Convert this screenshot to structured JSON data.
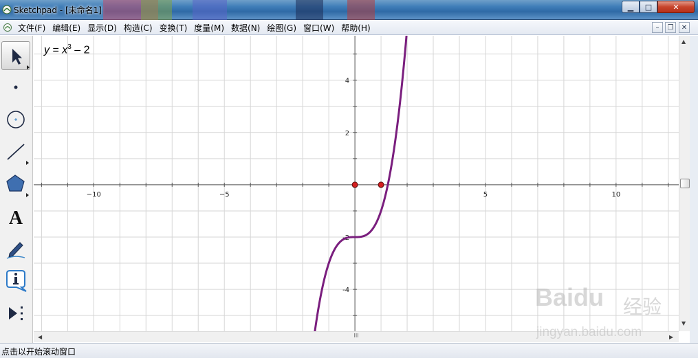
{
  "window": {
    "title": "Sketchpad  - [未命名1]",
    "min_glyph": "▁",
    "max_glyph": "□",
    "close_glyph": "✕"
  },
  "menu": {
    "items": [
      "文件(F)",
      "编辑(E)",
      "显示(D)",
      "构造(C)",
      "变换(T)",
      "度量(M)",
      "数据(N)",
      "绘图(G)",
      "窗口(W)",
      "帮助(H)"
    ],
    "mdi_min": "–",
    "mdi_restore": "❐",
    "mdi_close": "✕"
  },
  "toolbox": {
    "tools": [
      {
        "name": "arrow-tool",
        "icon": "arrow-pointer-icon",
        "selected": true
      },
      {
        "name": "point-tool",
        "icon": "point-icon"
      },
      {
        "name": "compass-tool",
        "icon": "circle-icon"
      },
      {
        "name": "straightedge-tool",
        "icon": "line-segment-icon"
      },
      {
        "name": "polygon-tool",
        "icon": "pentagon-icon"
      },
      {
        "name": "text-tool",
        "icon": "letter-a-icon"
      },
      {
        "name": "marker-tool",
        "icon": "pen-icon"
      },
      {
        "name": "information-tool",
        "icon": "info-icon"
      },
      {
        "name": "custom-tool",
        "icon": "play-more-icon"
      }
    ],
    "text_glyph": "A"
  },
  "graph": {
    "equation": {
      "lhs": "y",
      "eq": " = ",
      "var": "x",
      "exp": "3",
      "rest": " – 2"
    },
    "x_tick_labels": [
      {
        "value": -10,
        "text": "−10"
      },
      {
        "value": -5,
        "text": "−5"
      },
      {
        "value": 5,
        "text": "5"
      },
      {
        "value": 10,
        "text": "10"
      }
    ],
    "y_tick_labels": [
      {
        "value": 4,
        "text": "4"
      },
      {
        "value": 2,
        "text": "2"
      },
      {
        "value": -2,
        "text": "-2"
      },
      {
        "value": -4,
        "text": "-4"
      }
    ],
    "x_range": [
      -12.3,
      12.4
    ],
    "y_range": [
      -5.6,
      5.7
    ],
    "grid": true,
    "curve_color": "#7a1e7e",
    "point_color": "#d42020",
    "points": [
      {
        "x": 0,
        "y": 0
      },
      {
        "x": 1,
        "y": 0
      }
    ]
  },
  "scroll": {
    "up": "▲",
    "down": "▼",
    "left": "◀",
    "right": "▶",
    "h_thumb": "III"
  },
  "status": {
    "text": "点击以开始滚动窗口"
  },
  "watermark": {
    "brand": "Baidu",
    "brand_cn": "经验",
    "url": "jingyan.baidu.com"
  }
}
